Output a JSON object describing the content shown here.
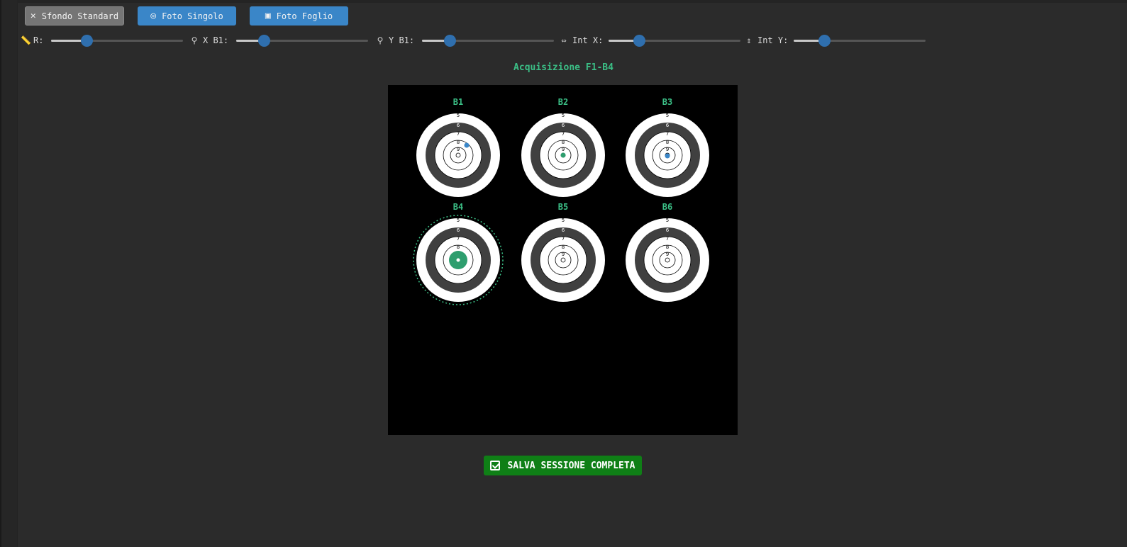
{
  "toolbar": {
    "standard_bg": {
      "label": "Sfondo Standard",
      "icon": "close-icon"
    },
    "single_photo": {
      "label": "Foto Singolo",
      "icon": "target-icon"
    },
    "sheet_photo": {
      "label": "Foto Foglio",
      "icon": "photo-icon"
    }
  },
  "sliders": [
    {
      "label": "R:",
      "icon": "ruler-icon",
      "value_fraction": 0.27
    },
    {
      "label": "X B1:",
      "icon": "pin-icon",
      "value_fraction": 0.21
    },
    {
      "label": "Y B1:",
      "icon": "pin-icon",
      "value_fraction": 0.21
    },
    {
      "label": "Int X:",
      "icon": "horizontal-arrows-icon",
      "value_fraction": 0.23
    },
    {
      "label": "Int Y:",
      "icon": "vertical-arrows-icon",
      "value_fraction": 0.23
    }
  ],
  "acquisition": {
    "title": "Acquisizione F1-B4",
    "accent_color": "#3bbf86",
    "shot_blue": "#3a86c8",
    "shot_green": "#2e9e6e",
    "targets": [
      {
        "name": "B1",
        "ring_labels": [
          "5",
          "6",
          "7",
          "8",
          "9"
        ],
        "selected": false,
        "shots": [
          {
            "color": "blue"
          }
        ]
      },
      {
        "name": "B2",
        "ring_labels": [
          "5",
          "6",
          "7",
          "8",
          "9"
        ],
        "selected": false,
        "shots": [
          {
            "color": "green"
          }
        ]
      },
      {
        "name": "B3",
        "ring_labels": [
          "5",
          "6",
          "7",
          "8",
          "9"
        ],
        "selected": false,
        "shots": [
          {
            "color": "blue"
          }
        ]
      },
      {
        "name": "B4",
        "ring_labels": [
          "5",
          "6",
          "7",
          "8",
          "9"
        ],
        "selected": true,
        "shots": [
          {
            "color": "green",
            "large": true
          }
        ]
      },
      {
        "name": "B5",
        "ring_labels": [
          "5",
          "6",
          "7",
          "8",
          "9"
        ],
        "selected": false,
        "shots": []
      },
      {
        "name": "B6",
        "ring_labels": [
          "5",
          "6",
          "7",
          "8",
          "9"
        ],
        "selected": false,
        "shots": []
      }
    ]
  },
  "save": {
    "label": "SALVA SESSIONE COMPLETA",
    "icon": "checkbox-icon",
    "color": "#0f7f16"
  }
}
